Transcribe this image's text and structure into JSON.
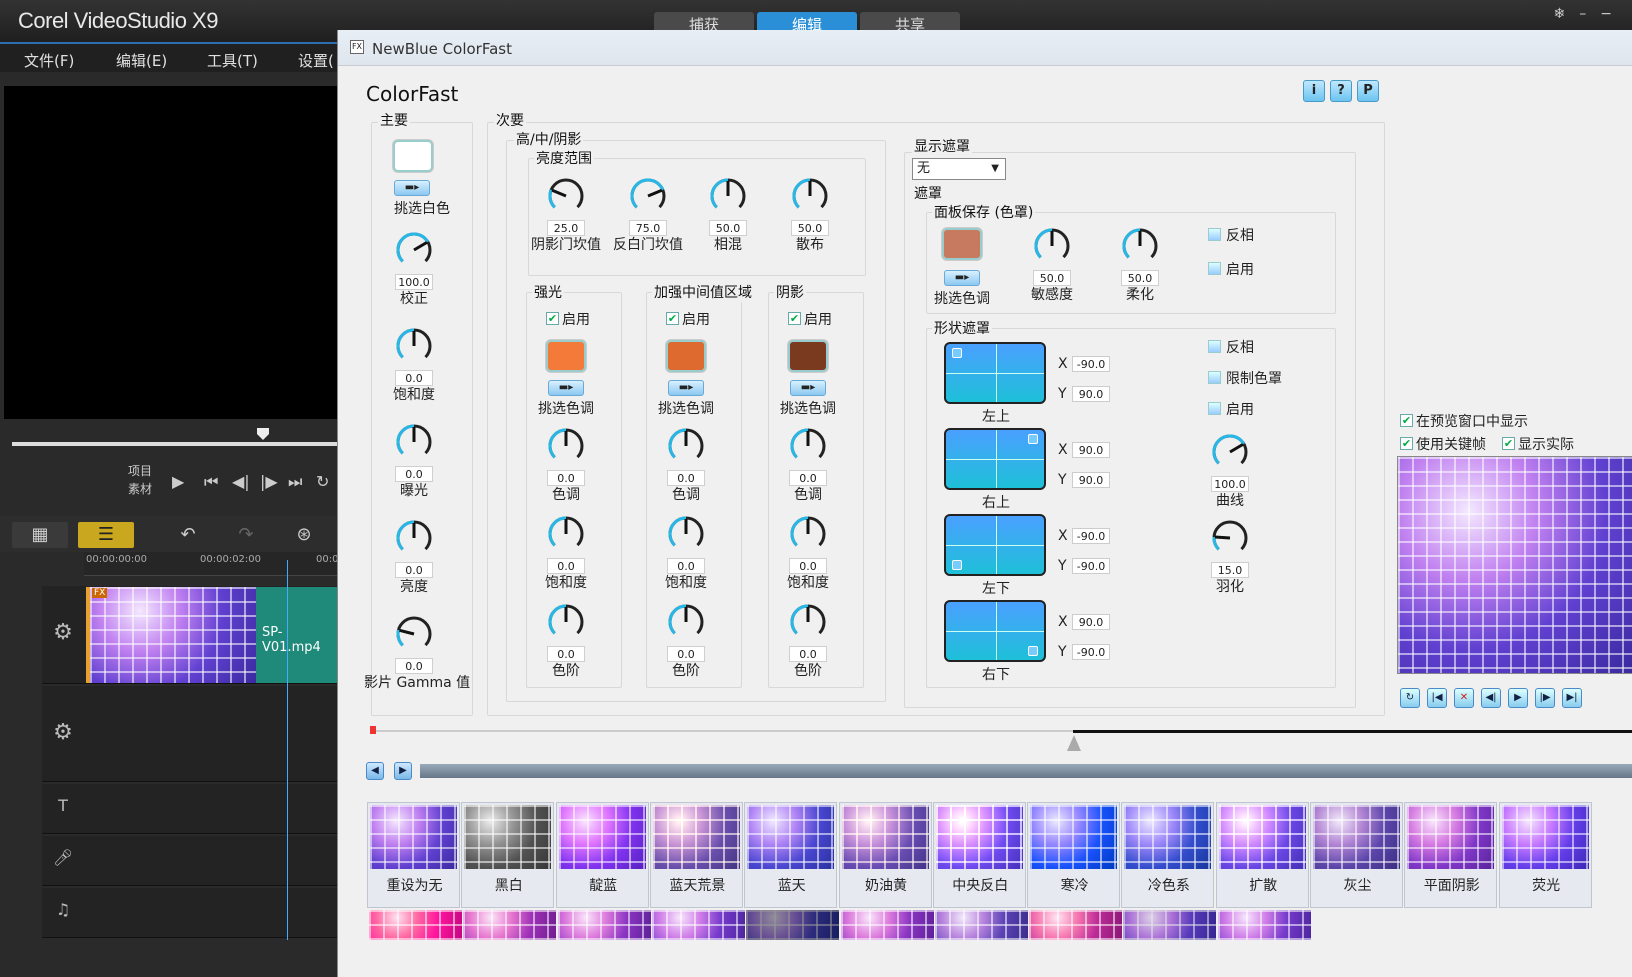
{
  "app": {
    "title": "Corel VideoStudio X9",
    "steps": [
      "捕获",
      "编辑",
      "共享"
    ],
    "active_step": 1
  },
  "menu": [
    "文件(F)",
    "编辑(E)",
    "工具(T)",
    "设置("
  ],
  "player": {
    "labels": [
      "项目",
      "素材"
    ],
    "buttons": [
      "▶",
      "⏮",
      "◀|",
      "|▶",
      "⏭",
      "↻"
    ]
  },
  "timeline": {
    "ruler": [
      "00:00:00:00",
      "00:00:02:00",
      "00:00"
    ],
    "clip_name": "SP-V01.mp4",
    "clip_badge": "FX"
  },
  "dialog": {
    "title": "NewBlue ColorFast",
    "fx_icon": "FX",
    "heading": "ColorFast",
    "info_buttons": [
      "i",
      "?",
      "P"
    ]
  },
  "primary": {
    "label": "主要",
    "pick_white": "挑选白色",
    "knobs": [
      {
        "value": "100.0",
        "label": "校正"
      },
      {
        "value": "0.0",
        "label": "饱和度"
      },
      {
        "value": "0.0",
        "label": "曝光"
      },
      {
        "value": "0.0",
        "label": "亮度"
      },
      {
        "value": "0.0",
        "label": "影片 Gamma 值"
      }
    ]
  },
  "secondary": {
    "label": "次要",
    "hml_label": "高/中/阴影",
    "range_label": "亮度范围",
    "range_knobs": [
      {
        "value": "25.0",
        "label": "阴影门坎值"
      },
      {
        "value": "75.0",
        "label": "反白门坎值"
      },
      {
        "value": "50.0",
        "label": "相混"
      },
      {
        "value": "50.0",
        "label": "散布"
      }
    ],
    "zones": [
      {
        "label": "强光",
        "enable": "启用",
        "color": "#f47a3a",
        "pick": "挑选色调",
        "knobs": [
          {
            "value": "0.0",
            "label": "色调"
          },
          {
            "value": "0.0",
            "label": "饱和度"
          },
          {
            "value": "0.0",
            "label": "色阶"
          }
        ]
      },
      {
        "label": "加强中间值区域",
        "enable": "启用",
        "color": "#de6a30",
        "pick": "挑选色调",
        "knobs": [
          {
            "value": "0.0",
            "label": "色调"
          },
          {
            "value": "0.0",
            "label": "饱和度"
          },
          {
            "value": "0.0",
            "label": "色阶"
          }
        ]
      },
      {
        "label": "阴影",
        "enable": "启用",
        "color": "#7a3a20",
        "pick": "挑选色调",
        "knobs": [
          {
            "value": "0.0",
            "label": "色调"
          },
          {
            "value": "0.0",
            "label": "饱和度"
          },
          {
            "value": "0.0",
            "label": "色阶"
          }
        ]
      }
    ]
  },
  "mask": {
    "show_label": "显示遮罩",
    "show_value": "无",
    "mask_label": "遮罩",
    "panel_label": "面板保存 (色罩)",
    "panel_color": "#c87a60",
    "pick": "挑选色调",
    "panel_knobs": [
      {
        "value": "50.0",
        "label": "敏感度"
      },
      {
        "value": "50.0",
        "label": "柔化"
      }
    ],
    "panel_checks": [
      "反相",
      "启用"
    ],
    "shape_label": "形状遮罩",
    "corners": [
      {
        "label": "左上",
        "x": "-90.0",
        "y": "90.0"
      },
      {
        "label": "右上",
        "x": "90.0",
        "y": "90.0"
      },
      {
        "label": "左下",
        "x": "-90.0",
        "y": "-90.0"
      },
      {
        "label": "右下",
        "x": "90.0",
        "y": "-90.0"
      }
    ],
    "shape_checks": [
      "反相",
      "限制色罩",
      "启用"
    ],
    "shape_knobs": [
      {
        "value": "100.0",
        "label": "曲线"
      },
      {
        "value": "15.0",
        "label": "羽化"
      }
    ]
  },
  "right_panel": {
    "checks": [
      "在预览窗口中显示",
      "使用关键帧",
      "显示实际"
    ]
  },
  "presets": [
    "重设为无",
    "黑白",
    "靛蓝",
    "蓝天荒景",
    "蓝天",
    "奶油黄",
    "中央反白",
    "寒冷",
    "冷色系",
    "扩散",
    "灰尘",
    "平面阴影",
    "荧光"
  ],
  "colors": {
    "accent": "#2b8fd8",
    "clip": "#1f8a7a"
  }
}
